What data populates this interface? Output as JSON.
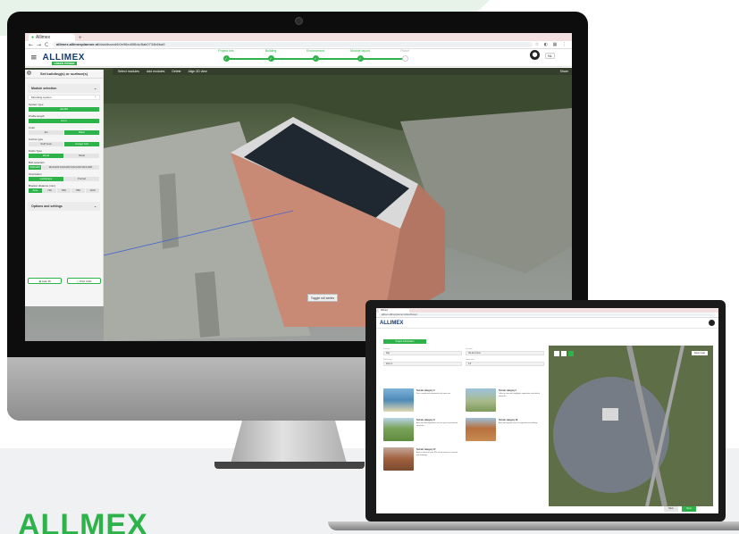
{
  "brand": {
    "text": "ALLMEX",
    "accent": "#2db34a",
    "navy": "#1a3a6b"
  },
  "desktop": {
    "browser": {
      "tab_title": "Allimex",
      "tab_plus": "+",
      "url_domain": "allimex.allimexplanner.nl",
      "url_path": "/dashboard/b0e96ed0f6dc/8ab0734b6ba9",
      "back": "←",
      "forward": "→",
      "reload": "C"
    },
    "header": {
      "logo": "ALLIMEX",
      "logo_sub": "GREEN POWER",
      "menu_icon": "hamburger-icon",
      "steps": [
        {
          "label": "Project info",
          "done": true
        },
        {
          "label": "Building",
          "done": true
        },
        {
          "label": "Environment",
          "done": true
        },
        {
          "label": "Module layout",
          "done": true
        },
        {
          "label": "Finish",
          "done": false
        }
      ],
      "lang": "NL"
    },
    "toolbar": {
      "items": [
        "Select modules",
        "Add modules",
        "Delete",
        "Align 3D view"
      ],
      "share": "Share"
    },
    "panel": {
      "title": "Set building(s) or surface(s)",
      "close": "×",
      "module_selection": "Module selection",
      "mounting": "Mounting system",
      "system_type_label": "System type",
      "system_type": "ALU30",
      "profile_length_label": "Profile length",
      "profile_length": "4,2 m",
      "color_label": "Color",
      "colors": [
        {
          "label": "Alu",
          "on": false
        },
        {
          "label": "Black",
          "on": true
        }
      ],
      "anchor_label": "Anchor type",
      "anchors": [
        {
          "label": "Stuff hook",
          "on": false
        },
        {
          "label": "Hanger bolt",
          "on": true
        }
      ],
      "purlin_label": "Purlin Type",
      "purlins": [
        {
          "label": "Wood",
          "on": true
        },
        {
          "label": "Metal",
          "on": false
        }
      ],
      "bolt_label": "Bolt selection",
      "bolts": [
        {
          "label": "M10x200",
          "on": true
        },
        {
          "label": "M10x200 M10x300 M12x200 M12x300",
          "on": false
        }
      ],
      "orientation_label": "Orientation",
      "orientations": [
        {
          "label": "Landscape",
          "on": true
        },
        {
          "label": "Portrait",
          "on": false
        }
      ],
      "bracket_label": "Bracket distance (mm)",
      "brackets": [
        {
          "label": "Auto",
          "on": true
        },
        {
          "label": "700",
          "on": false
        },
        {
          "label": "800",
          "on": false
        },
        {
          "label": "950",
          "on": false
        },
        {
          "label": "1100",
          "on": false
        }
      ],
      "options": "Options and settings",
      "auto_fill": "Auto fill",
      "print": "Print CAD"
    },
    "toggle_hint": "Toggle roll series"
  },
  "laptop": {
    "tab_title": "Allimex",
    "url": "allimex.allimexplanner.nl/dashboard",
    "logo": "ALLIMEX",
    "active_tab": "Project information",
    "fields": [
      {
        "label": "Country",
        "value": "Italy"
      },
      {
        "label": "Location",
        "value": "Via del Corso"
      },
      {
        "label": "Wind zone",
        "value": "Zone 2"
      },
      {
        "label": "Snow load",
        "value": "0,5"
      }
    ],
    "cards": [
      {
        "title": "Terrain category 0",
        "desc": "Sea, coastal area exposed to the open sea"
      },
      {
        "title": "Terrain category I",
        "desc": "Lakes or area with negligible vegetation and without obstacles"
      },
      {
        "title": "Terrain category II",
        "desc": "Area with low vegetation such as grass and isolated obstacles"
      },
      {
        "title": "Terrain category III",
        "desc": "Area with regular cover of vegetation or buildings"
      },
      {
        "title": "Terrain category IV",
        "desc": "Area in which at least 15% of the surface is covered with buildings"
      }
    ],
    "map_button": "Reset map",
    "back": "Back",
    "next": "Next"
  }
}
